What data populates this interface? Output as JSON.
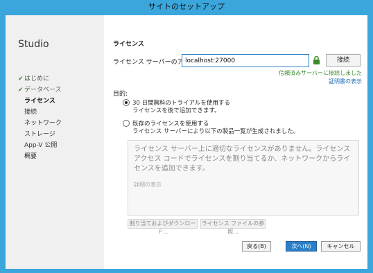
{
  "window": {
    "title": "サイトのセットアップ"
  },
  "sidebar": {
    "brand": "Studio",
    "items": [
      {
        "label": "はじめに",
        "done": true,
        "active": false
      },
      {
        "label": "データベース",
        "done": true,
        "active": false
      },
      {
        "label": "ライセンス",
        "done": false,
        "active": true
      },
      {
        "label": "接続",
        "done": false,
        "active": false
      },
      {
        "label": "ネットワーク",
        "done": false,
        "active": false
      },
      {
        "label": "ストレージ",
        "done": false,
        "active": false
      },
      {
        "label": "App-V 公開",
        "done": false,
        "active": false
      },
      {
        "label": "概要",
        "done": false,
        "active": false
      }
    ]
  },
  "main": {
    "section_title": "ライセンス",
    "server_label": "ライセンス サーバーのアドレス:",
    "server_value": "localhost:27000",
    "connect_button": "接続",
    "trusted_text": "信頼済みサーバーに接続しました",
    "cert_link": "証明書の表示",
    "purpose_label": "目的:",
    "option_trial": {
      "label": "30 日間無料のトライアルを使用する",
      "sub": "ライセンスを後で追加できます。",
      "checked": true
    },
    "option_existing": {
      "label": "既存のライセンスを使用する",
      "sub": "ライセンス サーバーにより以下の製品一覧が生成されました。",
      "checked": false
    },
    "message": "ライセンス サーバー上に適切なライセンスがありません。ライセンス アクセス コードでライセンスを割り当てるか、ネットワークからライセンスを追加できます。",
    "details_link": "詳細の表示",
    "assign_button": "割り当ておよびダウンロード...",
    "browse_button": "ライセンス ファイルの参照..."
  },
  "footer": {
    "back_button": "戻る(B)",
    "next_button": "次へ(N)",
    "cancel_button": "キャンセル"
  },
  "colors": {
    "titlebar": "#3aa6dc",
    "accent": "#2b7fc6",
    "success": "#3b8a2a",
    "link": "#1f6cb5"
  }
}
